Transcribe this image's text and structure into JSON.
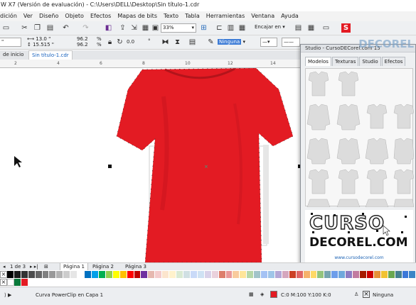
{
  "window": {
    "title": "W X7 (Versión de evaluación) - C:\\Users\\DELL\\Desktop\\Sin título-1.cdr"
  },
  "menu": [
    "dición",
    "Ver",
    "Diseño",
    "Objeto",
    "Efectos",
    "Mapas de bits",
    "Texto",
    "Tabla",
    "Herramientas",
    "Ventana",
    "Ayuda"
  ],
  "toolbar": {
    "zoom": "33%",
    "snap_label": "Encajar en",
    "fill_none": "Ninguna"
  },
  "propbar": {
    "pos_x": "13.0 \"",
    "pos_y": "15.515 \"",
    "scale_x": "96.2",
    "scale_y": "96.2",
    "pct": "%",
    "angle": "0.0",
    "deg": "°"
  },
  "doc_tabs": [
    "de inicio",
    "Sin título-1.cdr"
  ],
  "ruler": {
    "marks": [
      "2",
      "4",
      "6",
      "8",
      "10",
      "12",
      "14"
    ]
  },
  "docker": {
    "title": "Studio - CursoDECorel.com 15",
    "tabs": [
      "Modelos",
      "Texturas",
      "Studio",
      "Efectos"
    ],
    "logo_top": "CURSO",
    "logo_bottom": "DECOREL.COM",
    "logo_url": "www.cursodecorel.com",
    "watermark": "DECOREL"
  },
  "pagebar": {
    "counter": "1 de 3",
    "pages": [
      "Página 1",
      "Página 2",
      "Página 3"
    ]
  },
  "status": {
    "object": "Curva PowerClip en Capa 1",
    "fill": "C:0 M:100 Y:100 K:0",
    "outline": "Ninguna"
  },
  "colors": {
    "shirt": "#e31b23",
    "palette": [
      "#000000",
      "#1a1a1a",
      "#333333",
      "#4d4d4d",
      "#666666",
      "#808080",
      "#999999",
      "#b3b3b3",
      "#cccccc",
      "#e6e6e6",
      "#ffffff",
      "#0070c0",
      "#00a0e9",
      "#00b050",
      "#92d050",
      "#ffff00",
      "#ffc000",
      "#ff0000",
      "#c00000",
      "#7030a0",
      "#e6b8af",
      "#f4cccc",
      "#fce5cd",
      "#fff2cc",
      "#d9ead3",
      "#d0e0e3",
      "#c9daf8",
      "#cfe2f3",
      "#d9d2e9",
      "#ead1dc",
      "#dd7e6b",
      "#ea9999",
      "#f9cb9c",
      "#ffe599",
      "#b6d7a8",
      "#a2c4c9",
      "#a4c2f4",
      "#9fc5e8",
      "#b4a7d6",
      "#d5a6bd",
      "#cc4125",
      "#e06666",
      "#f6b26b",
      "#ffd966",
      "#93c47d",
      "#76a5af",
      "#6d9eeb",
      "#6fa8dc",
      "#8e7cc3",
      "#c27ba0",
      "#a61c00",
      "#cc0000",
      "#e69138",
      "#f1c232",
      "#6aa84f",
      "#45818e",
      "#3c78d8",
      "#3d85c6"
    ]
  }
}
